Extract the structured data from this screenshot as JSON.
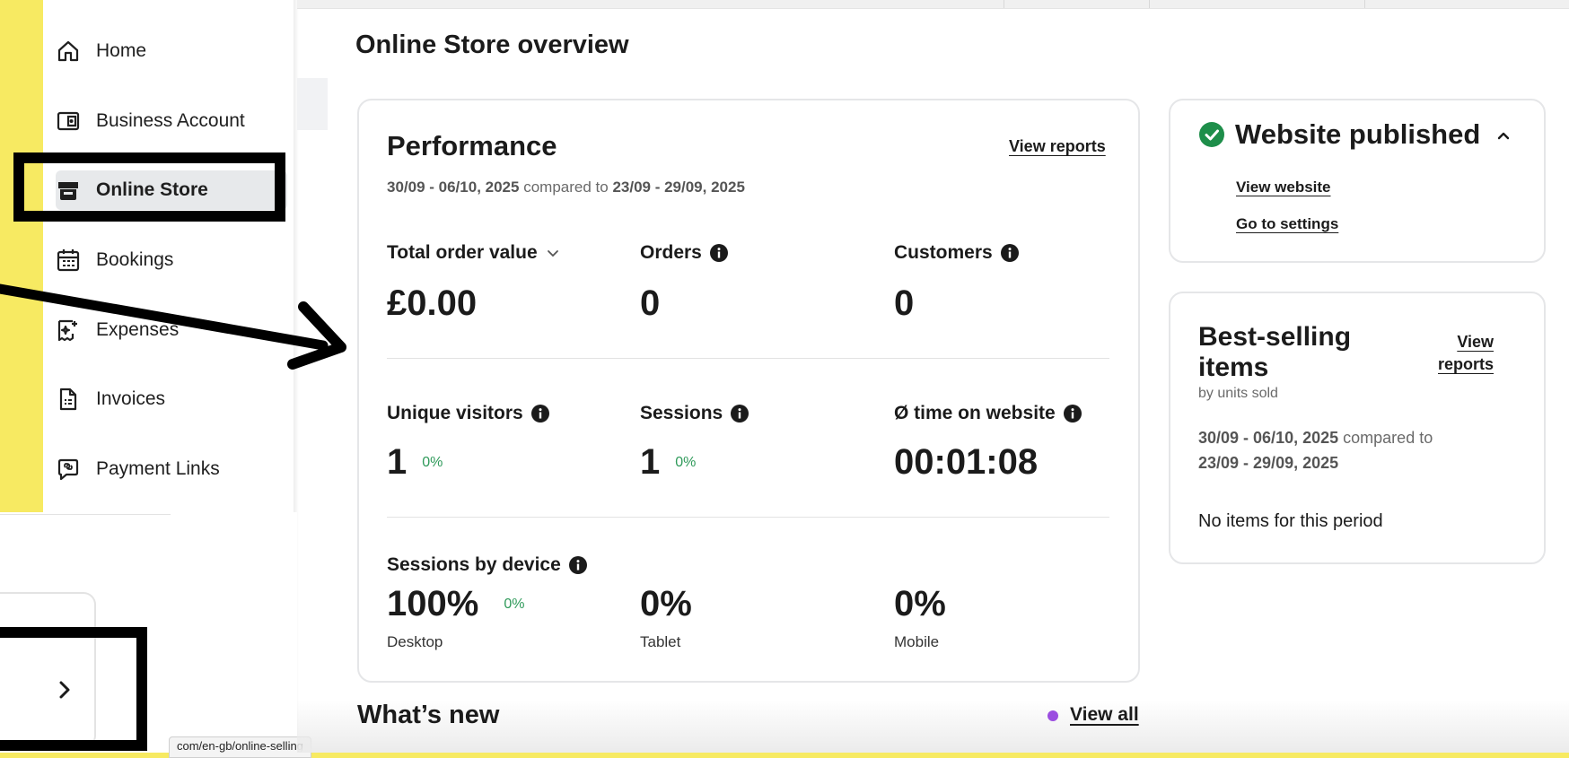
{
  "sidebar": {
    "items": [
      {
        "label": "Home",
        "icon": "home-icon"
      },
      {
        "label": "Business Account",
        "icon": "wallet-icon"
      },
      {
        "label": "Online Store",
        "icon": "store-icon",
        "active": true
      },
      {
        "label": "Bookings",
        "icon": "calendar-icon"
      },
      {
        "label": "Expenses",
        "icon": "receipt-sparkle-icon"
      },
      {
        "label": "Invoices",
        "icon": "invoice-icon"
      },
      {
        "label": "Payment Links",
        "icon": "link-icon"
      }
    ]
  },
  "status_url": "com/en-gb/online-selling",
  "main": {
    "title": "Online Store overview",
    "performance": {
      "title": "Performance",
      "view_reports": "View reports",
      "date_current": "30/09 - 06/10, 2025",
      "compared_to": "compared to",
      "date_previous": "23/09 - 29/09, 2025",
      "metrics": {
        "total_order_value": {
          "label": "Total order value",
          "value": "£0.00"
        },
        "orders": {
          "label": "Orders",
          "value": "0"
        },
        "customers": {
          "label": "Customers",
          "value": "0"
        },
        "unique_visitors": {
          "label": "Unique visitors",
          "value": "1",
          "delta": "0%"
        },
        "sessions": {
          "label": "Sessions",
          "value": "1",
          "delta": "0%"
        },
        "time_on_website": {
          "label": "Ø time on website",
          "value": "00:01:08"
        }
      },
      "devices": {
        "label": "Sessions by device",
        "desktop": {
          "value": "100%",
          "delta": "0%",
          "label": "Desktop"
        },
        "tablet": {
          "value": "0%",
          "label": "Tablet"
        },
        "mobile": {
          "value": "0%",
          "label": "Mobile"
        }
      }
    },
    "published": {
      "title": "Website published",
      "view_website": "View website",
      "go_to_settings": "Go to settings"
    },
    "best_selling": {
      "title": "Best-selling items",
      "view_reports_line1": "View",
      "view_reports_line2": "reports",
      "subtitle": "by units sold",
      "date_current": "30/09 - 06/10, 2025",
      "compared_to": "compared to",
      "date_previous": "23/09 - 29/09, 2025",
      "empty": "No items for this period"
    },
    "whats_new": {
      "title": "What’s new",
      "view_all": "View all"
    }
  },
  "colors": {
    "background_highlight": "#f7ea62",
    "success_green": "#1e8e4a",
    "delta_green": "#2f9a5a",
    "new_dot_purple": "#9b4de0",
    "annotation": "#000000"
  }
}
